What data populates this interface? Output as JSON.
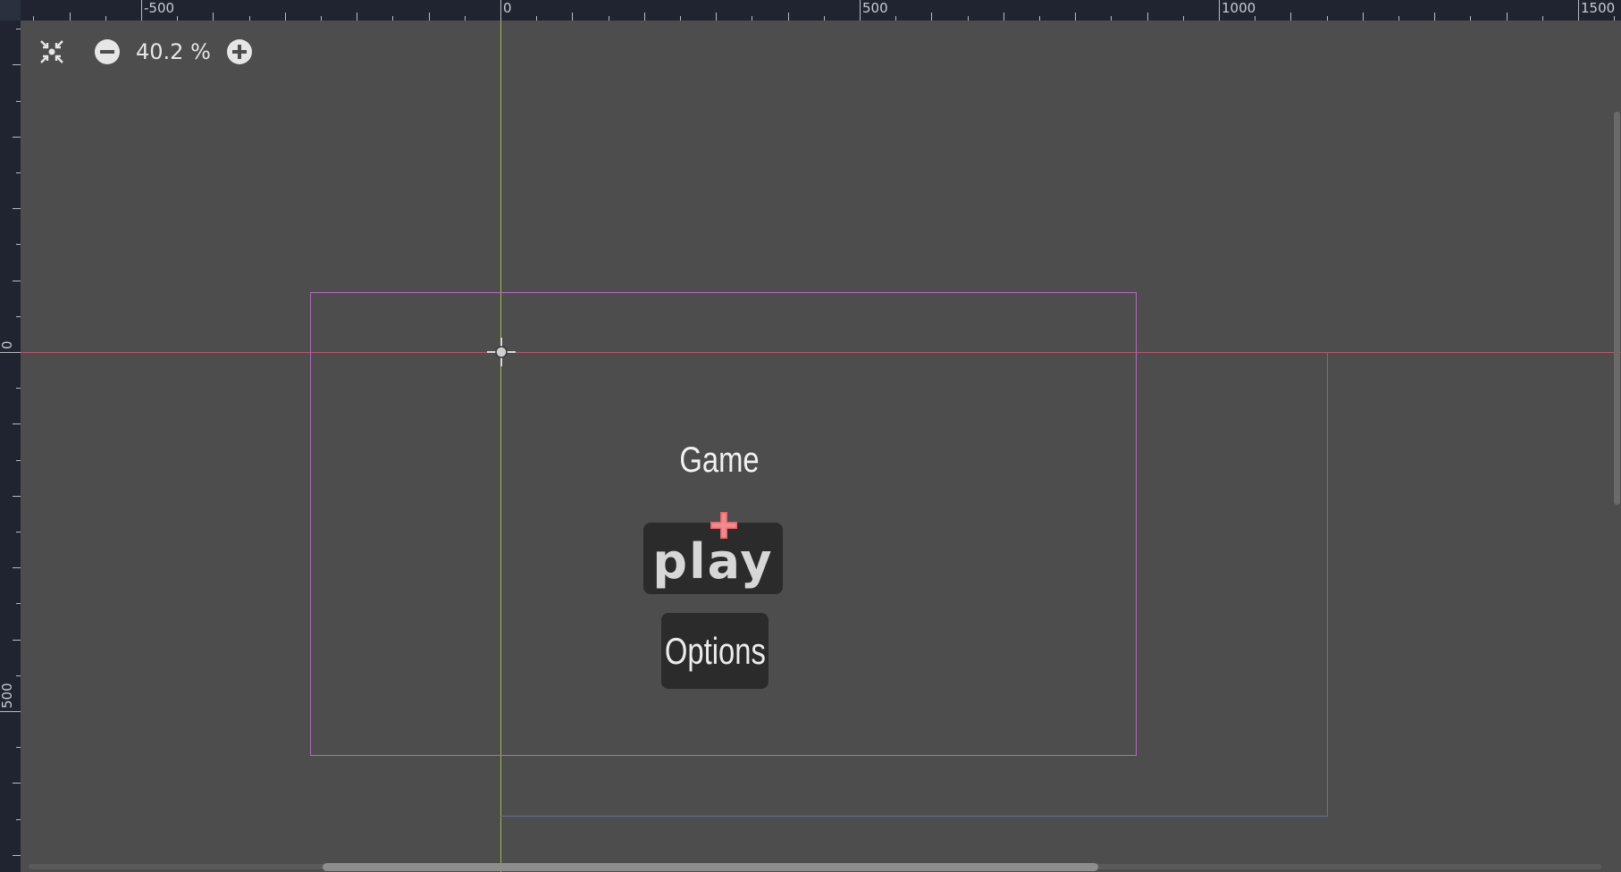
{
  "toolbar": {
    "zoom_level": "40.2 %",
    "center_view_icon": "center-view-icon",
    "zoom_out_icon": "zoom-out-icon",
    "zoom_in_icon": "zoom-in-icon"
  },
  "rulers": {
    "horizontal_labels": [
      "-500",
      "0",
      "500",
      "1000",
      "1500"
    ],
    "vertical_labels": [
      "0",
      "500"
    ]
  },
  "scene": {
    "title_label": "Game",
    "play_button": "play",
    "options_button": "Options"
  },
  "colors": {
    "editor_background": "#4d4d4d",
    "ruler_background": "#1f2430",
    "guide_vertical": "#9fb85a",
    "guide_horizontal": "#b8576c",
    "camera_frame": "#b46bbf",
    "button_background": "#2b2b2b",
    "pivot_marker": "#e0666b"
  }
}
